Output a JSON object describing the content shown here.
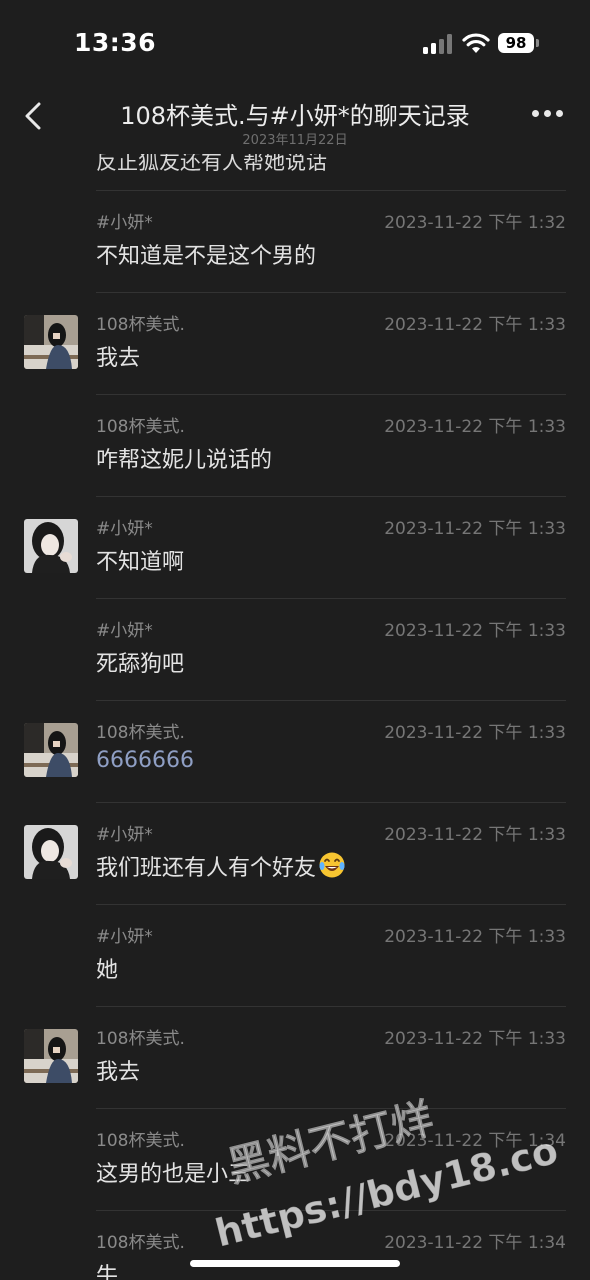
{
  "status_bar": {
    "time": "13:36",
    "battery": "98"
  },
  "nav": {
    "title": "108杯美式.与#小妍*的聊天记录",
    "subtitle": "2023年11月22日"
  },
  "partial_message": "反正狐友还有人帮她说话",
  "messages": [
    {
      "sender": "#小妍*",
      "time": "2023-11-22 下午 1:32",
      "text": "不知道是不是这个男的",
      "avatar": "none"
    },
    {
      "sender": "108杯美式.",
      "time": "2023-11-22 下午 1:33",
      "text": "我去",
      "avatar": "user-photo"
    },
    {
      "sender": "108杯美式.",
      "time": "2023-11-22 下午 1:33",
      "text": "咋帮这妮儿说话的",
      "avatar": "none"
    },
    {
      "sender": "#小妍*",
      "time": "2023-11-22 下午 1:33",
      "text": "不知道啊",
      "avatar": "girl-photo"
    },
    {
      "sender": "#小妍*",
      "time": "2023-11-22 下午 1:33",
      "text": "死舔狗吧",
      "avatar": "none"
    },
    {
      "sender": "108杯美式.",
      "time": "2023-11-22 下午 1:33",
      "text": "6666666",
      "avatar": "user-photo",
      "link": true
    },
    {
      "sender": "#小妍*",
      "time": "2023-11-22 下午 1:33",
      "text": "我们班还有人有个好友",
      "avatar": "girl-photo",
      "emoji": "laughing-tears-emoji"
    },
    {
      "sender": "#小妍*",
      "time": "2023-11-22 下午 1:33",
      "text": "她",
      "avatar": "none"
    },
    {
      "sender": "108杯美式.",
      "time": "2023-11-22 下午 1:33",
      "text": "我去",
      "avatar": "user-photo"
    },
    {
      "sender": "108杯美式.",
      "time": "2023-11-22 下午 1:34",
      "text": "这男的也是小三",
      "avatar": "none"
    },
    {
      "sender": "108杯美式.",
      "time": "2023-11-22 下午 1:34",
      "text": "牛",
      "avatar": "none"
    }
  ],
  "watermark": {
    "line1": "黑料不打烊",
    "line2": "https://bdy18.co"
  },
  "colors": {
    "background": "#1e1e1e",
    "link": "#8f9fc4",
    "separator": "#333333"
  }
}
